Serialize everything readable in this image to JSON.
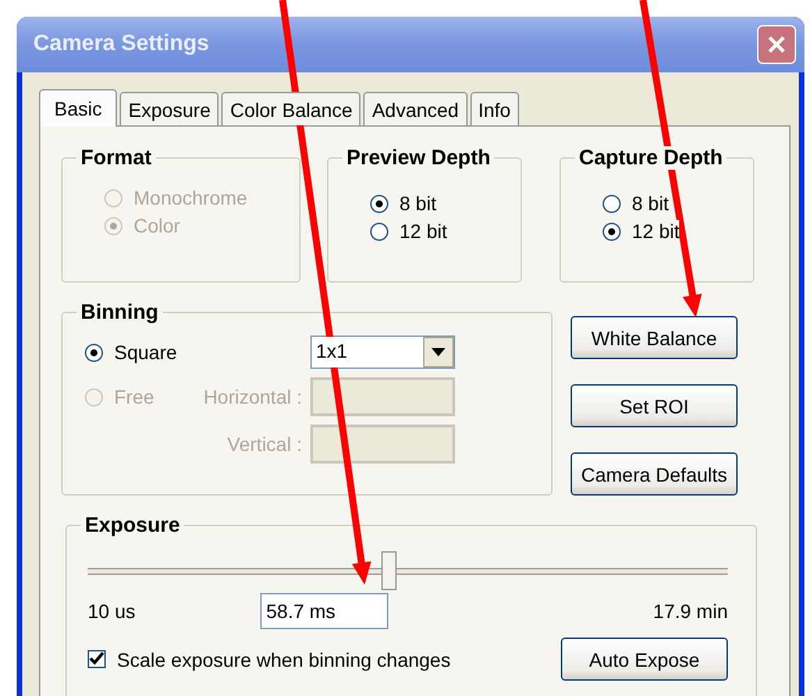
{
  "window": {
    "title": "Camera Settings"
  },
  "tabs": [
    {
      "label": "Basic",
      "selected": true
    },
    {
      "label": "Exposure",
      "selected": false
    },
    {
      "label": "Color Balance",
      "selected": false
    },
    {
      "label": "Advanced",
      "selected": false
    },
    {
      "label": "Info",
      "selected": false
    }
  ],
  "format": {
    "title": "Format",
    "options": [
      {
        "label": "Monochrome",
        "selected": false,
        "disabled": true
      },
      {
        "label": "Color",
        "selected": true,
        "disabled": true
      }
    ]
  },
  "preview_depth": {
    "title": "Preview Depth",
    "options": [
      {
        "label": "8 bit",
        "selected": true,
        "disabled": false
      },
      {
        "label": "12 bit",
        "selected": false,
        "disabled": false
      }
    ]
  },
  "capture_depth": {
    "title": "Capture Depth",
    "options": [
      {
        "label": "8 bit",
        "selected": false,
        "disabled": false
      },
      {
        "label": "12 bit",
        "selected": true,
        "disabled": false
      }
    ]
  },
  "binning": {
    "title": "Binning",
    "options": [
      {
        "label": "Square",
        "selected": true,
        "disabled": false
      },
      {
        "label": "Free",
        "selected": false,
        "disabled": true
      }
    ],
    "size_value": "1x1",
    "fields": [
      {
        "label": "Horizontal :",
        "disabled": true
      },
      {
        "label": "Vertical :",
        "disabled": true
      }
    ]
  },
  "buttons": [
    "White Balance",
    "Set ROI",
    "Camera Defaults"
  ],
  "exposure": {
    "title": "Exposure",
    "level": 0.47,
    "min_label": "10 us",
    "max_label": "17.9 min",
    "value": "58.7 ms",
    "scale_option": {
      "label": "Scale exposure when binning changes",
      "checked": true
    },
    "auto_button": "Auto Expose"
  }
}
